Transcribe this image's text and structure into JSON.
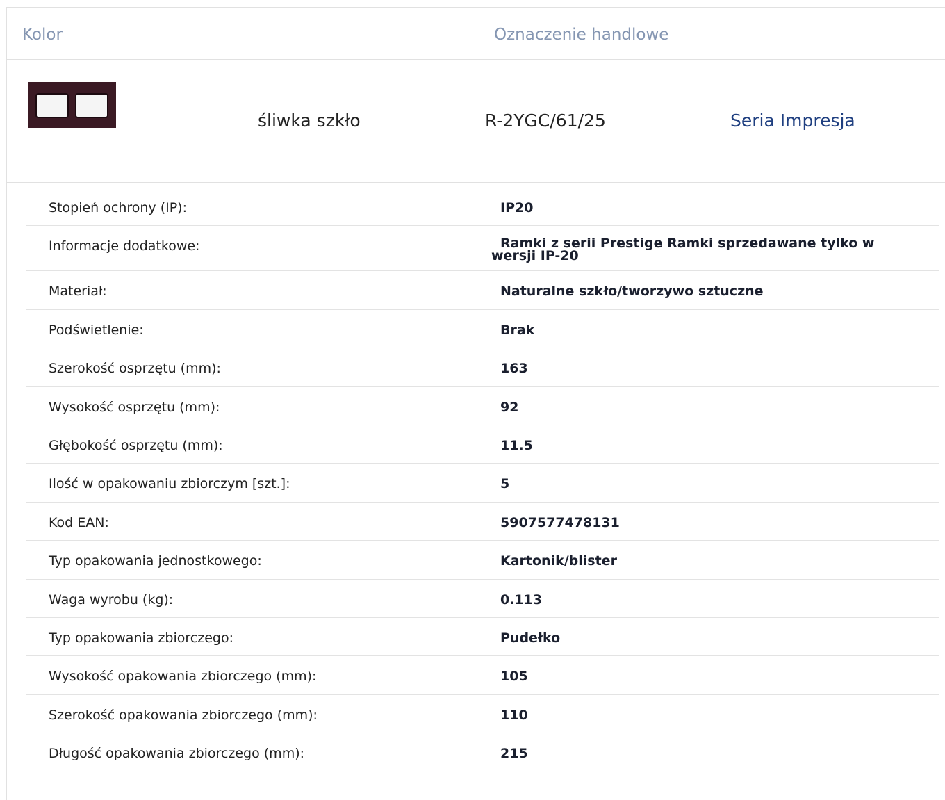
{
  "header": {
    "color_label": "Kolor",
    "trade_label": "Oznaczenie handlowe"
  },
  "product": {
    "color_name": "śliwka szkło",
    "code": "R-2YGC/61/25",
    "series_link": "Seria Impresja",
    "swatch_color": "#3b1a24",
    "link_color": "#1f3f80"
  },
  "specs": [
    {
      "label": "Stopień ochrony (IP):",
      "value": "IP20"
    },
    {
      "label": "Informacje dodatkowe:",
      "value": "Ramki z serii Prestige Ramki sprzedawane tylko w wersji IP-20"
    },
    {
      "label": "Materiał:",
      "value": "Naturalne szkło/tworzywo sztuczne"
    },
    {
      "label": "Podświetlenie:",
      "value": "Brak"
    },
    {
      "label": "Szerokość osprzętu (mm):",
      "value": "163"
    },
    {
      "label": "Wysokość osprzętu (mm):",
      "value": "92"
    },
    {
      "label": "Głębokość osprzętu (mm):",
      "value": "11.5"
    },
    {
      "label": "Ilość w opakowaniu zbiorczym [szt.]:",
      "value": "5"
    },
    {
      "label": "Kod EAN:",
      "value": "5907577478131"
    },
    {
      "label": "Typ opakowania jednostkowego:",
      "value": "Kartonik/blister"
    },
    {
      "label": "Waga wyrobu (kg):",
      "value": "0.113"
    },
    {
      "label": "Typ opakowania zbiorczego:",
      "value": "Pudełko"
    },
    {
      "label": "Wysokość opakowania zbiorczego (mm):",
      "value": "105"
    },
    {
      "label": "Szerokość opakowania zbiorczego (mm):",
      "value": "110"
    },
    {
      "label": "Długość opakowania zbiorczego (mm):",
      "value": "215"
    }
  ]
}
